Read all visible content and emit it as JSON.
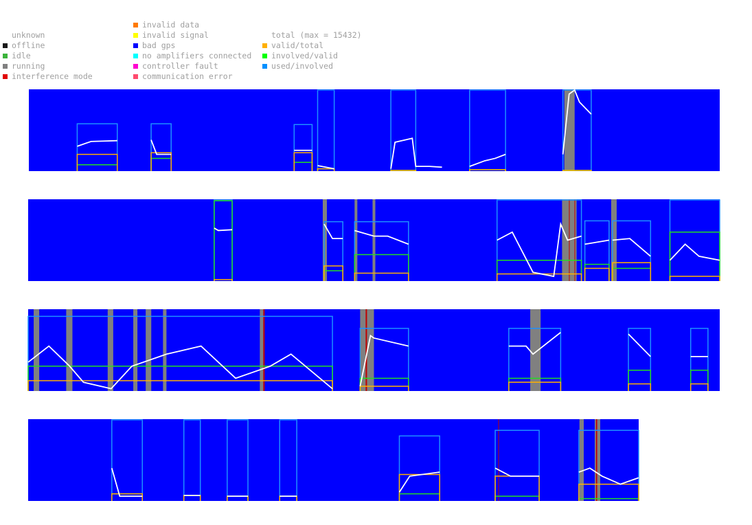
{
  "legend": {
    "columns": [
      [
        {
          "label": "unknown",
          "color": null
        },
        {
          "label": "offline",
          "color": "#1a1a1a"
        },
        {
          "label": "idle",
          "color": "#3cb33c"
        },
        {
          "label": "running",
          "color": "#808080"
        },
        {
          "label": "interference mode",
          "color": "#e00000"
        }
      ],
      [
        {
          "label": "invalid data",
          "color": "#ff7a00"
        },
        {
          "label": "invalid signal",
          "color": "#ffff00"
        },
        {
          "label": "bad gps",
          "color": "#0000ff"
        },
        {
          "label": "no amplifiers connected",
          "color": "#00ffff"
        },
        {
          "label": "controller fault",
          "color": "#ff00d0"
        },
        {
          "label": "communication error",
          "color": "#ff4a6e"
        }
      ],
      [
        {
          "label": "total (max = 15432)",
          "color": null
        },
        {
          "label": "valid/total",
          "color": "#ffb000"
        },
        {
          "label": "involved/valid",
          "color": "#00ff00"
        },
        {
          "label": "used/involved",
          "color": "#0090ff"
        }
      ]
    ]
  },
  "colors": {
    "background": "#0000ff",
    "total": "#ffffff",
    "valid_total": "#ffb000",
    "involved_valid": "#22dd22",
    "used_involved": "#1e90ff",
    "running": "#808080",
    "interference": "#c00000"
  },
  "chart_data": {
    "type": "line",
    "y_range": [
      0,
      1
    ],
    "series_names": [
      "total (max = 15432)",
      "valid/total",
      "involved/valid",
      "used/involved"
    ],
    "strips": [
      {
        "x_range": [
          0,
          1
        ],
        "segments": [
          {
            "x": [
              0.07,
              0.128
            ],
            "used": 0.58,
            "involved": 0.07,
            "valid": 0.2,
            "total": [
              [
                0.07,
                0.3
              ],
              [
                0.09,
                0.36
              ],
              [
                0.128,
                0.37
              ]
            ]
          },
          {
            "x": [
              0.177,
              0.206
            ],
            "used": 0.58,
            "involved": 0.15,
            "valid": 0.22,
            "total": [
              [
                0.177,
                0.38
              ],
              [
                0.185,
                0.2
              ],
              [
                0.206,
                0.2
              ]
            ]
          },
          {
            "x": [
              0.384,
              0.41
            ],
            "used": 0.57,
            "involved": 0.1,
            "valid": 0.22,
            "total": [
              [
                0.384,
                0.25
              ],
              [
                0.41,
                0.25
              ]
            ]
          },
          {
            "x": [
              0.418,
              0.442
            ],
            "used": 1.0,
            "involved": 0.02,
            "valid": 0.02,
            "total": [
              [
                0.418,
                0.06
              ],
              [
                0.442,
                0.02
              ]
            ]
          },
          {
            "x": [
              0.524,
              0.56
            ],
            "used": 1.0,
            "involved": 0.0,
            "valid": 0.0,
            "total": [
              [
                0.524,
                0.02
              ],
              [
                0.53,
                0.35
              ],
              [
                0.555,
                0.4
              ],
              [
                0.56,
                0.05
              ],
              [
                0.58,
                0.05
              ],
              [
                0.598,
                0.04
              ]
            ]
          },
          {
            "x": [
              0.638,
              0.69
            ],
            "used": 1.0,
            "involved": 0.01,
            "valid": 0.01,
            "total": [
              [
                0.638,
                0.05
              ],
              [
                0.66,
                0.12
              ],
              [
                0.675,
                0.15
              ],
              [
                0.69,
                0.2
              ]
            ]
          },
          {
            "x": [
              0.773,
              0.814
            ],
            "used": 1.0,
            "involved": 0.0,
            "valid": 0.0,
            "total": [
              [
                0.773,
                0.2
              ],
              [
                0.782,
                0.95
              ],
              [
                0.79,
                1.0
              ],
              [
                0.797,
                0.85
              ],
              [
                0.814,
                0.7
              ]
            ]
          }
        ],
        "running": [
          [
            0.775,
            0.79
          ]
        ],
        "interference": []
      },
      {
        "x_range": [
          0,
          1
        ],
        "segments": [
          {
            "x": [
              0.269,
              0.295
            ],
            "used": 1.0,
            "involved": 0.99,
            "valid": 0.01,
            "total": [
              [
                0.269,
                0.65
              ],
              [
                0.275,
                0.62
              ],
              [
                0.295,
                0.63
              ]
            ]
          },
          {
            "x": [
              0.428,
              0.455
            ],
            "used": 0.73,
            "involved": 0.12,
            "valid": 0.18,
            "total": [
              [
                0.428,
                0.7
              ],
              [
                0.44,
                0.52
              ],
              [
                0.455,
                0.52
              ]
            ]
          },
          {
            "x": [
              0.472,
              0.55
            ],
            "used": 0.73,
            "involved": 0.32,
            "valid": 0.09,
            "total": [
              [
                0.472,
                0.62
              ],
              [
                0.5,
                0.55
              ],
              [
                0.52,
                0.55
              ],
              [
                0.55,
                0.45
              ]
            ]
          },
          {
            "x": [
              0.678,
              0.8
            ],
            "used": 1.0,
            "involved": 0.25,
            "valid": 0.08,
            "total": [
              [
                0.678,
                0.5
              ],
              [
                0.7,
                0.6
              ],
              [
                0.73,
                0.1
              ],
              [
                0.76,
                0.05
              ],
              [
                0.77,
                0.7
              ],
              [
                0.78,
                0.5
              ],
              [
                0.8,
                0.55
              ]
            ]
          },
          {
            "x": [
              0.805,
              0.84
            ],
            "used": 0.74,
            "involved": 0.2,
            "valid": 0.15,
            "total": [
              [
                0.805,
                0.45
              ],
              [
                0.84,
                0.5
              ]
            ]
          },
          {
            "x": [
              0.845,
              0.9
            ],
            "used": 0.74,
            "involved": 0.15,
            "valid": 0.22,
            "total": [
              [
                0.845,
                0.5
              ],
              [
                0.87,
                0.52
              ],
              [
                0.9,
                0.3
              ]
            ]
          },
          {
            "x": [
              0.928,
              1.0
            ],
            "used": 1.0,
            "involved": 0.6,
            "valid": 0.05,
            "total": [
              [
                0.928,
                0.25
              ],
              [
                0.95,
                0.45
              ],
              [
                0.97,
                0.3
              ],
              [
                1.0,
                0.25
              ]
            ]
          }
        ],
        "running": [
          [
            0.426,
            0.432
          ],
          [
            0.472,
            0.476
          ],
          [
            0.498,
            0.502
          ],
          [
            0.772,
            0.793
          ],
          [
            0.843,
            0.851
          ]
        ],
        "interference": [
          [
            0.782,
            0.783
          ],
          [
            0.79,
            0.791
          ]
        ]
      },
      {
        "x_range": [
          0,
          1
        ],
        "segments": [
          {
            "x": [
              0.0,
              0.44
            ],
            "used": 0.92,
            "involved": 0.3,
            "valid": 0.12,
            "total": [
              [
                0.0,
                0.35
              ],
              [
                0.03,
                0.55
              ],
              [
                0.06,
                0.3
              ],
              [
                0.08,
                0.1
              ],
              [
                0.12,
                0.02
              ],
              [
                0.15,
                0.3
              ],
              [
                0.2,
                0.45
              ],
              [
                0.25,
                0.55
              ],
              [
                0.3,
                0.15
              ],
              [
                0.35,
                0.3
              ],
              [
                0.38,
                0.45
              ],
              [
                0.44,
                0.02
              ]
            ]
          },
          {
            "x": [
              0.48,
              0.55
            ],
            "used": 0.77,
            "involved": 0.15,
            "valid": 0.05,
            "total": [
              [
                0.48,
                0.05
              ],
              [
                0.495,
                0.68
              ],
              [
                0.5,
                0.65
              ],
              [
                0.55,
                0.55
              ]
            ]
          },
          {
            "x": [
              0.695,
              0.77
            ],
            "used": 0.77,
            "involved": 0.15,
            "valid": 0.1,
            "total": [
              [
                0.695,
                0.55
              ],
              [
                0.72,
                0.55
              ],
              [
                0.73,
                0.45
              ],
              [
                0.77,
                0.72
              ]
            ]
          },
          {
            "x": [
              0.868,
              0.9
            ],
            "used": 0.77,
            "involved": 0.25,
            "valid": 0.08,
            "total": [
              [
                0.868,
                0.7
              ],
              [
                0.9,
                0.42
              ]
            ]
          },
          {
            "x": [
              0.958,
              0.983
            ],
            "used": 0.77,
            "involved": 0.25,
            "valid": 0.08,
            "total": [
              [
                0.958,
                0.42
              ],
              [
                0.983,
                0.42
              ]
            ]
          }
        ],
        "running": [
          [
            0.008,
            0.016
          ],
          [
            0.055,
            0.064
          ],
          [
            0.115,
            0.123
          ],
          [
            0.152,
            0.158
          ],
          [
            0.17,
            0.178
          ],
          [
            0.195,
            0.2
          ],
          [
            0.335,
            0.34
          ],
          [
            0.48,
            0.5
          ],
          [
            0.726,
            0.741
          ]
        ],
        "interference": [
          [
            0.34,
            0.342
          ],
          [
            0.488,
            0.49
          ]
        ]
      },
      {
        "x_range": [
          0,
          1
        ],
        "segments": [
          {
            "x": [
              0.137,
              0.187
            ],
            "used": 1.0,
            "involved": 0.08,
            "valid": 0.08,
            "total": [
              [
                0.137,
                0.4
              ],
              [
                0.15,
                0.05
              ],
              [
                0.187,
                0.05
              ]
            ]
          },
          {
            "x": [
              0.255,
              0.282
            ],
            "used": 1.0,
            "involved": 0.06,
            "valid": 0.06,
            "total": [
              [
                0.255,
                0.06
              ],
              [
                0.282,
                0.06
              ]
            ]
          },
          {
            "x": [
              0.326,
              0.36
            ],
            "used": 1.0,
            "involved": 0.05,
            "valid": 0.05,
            "total": [
              [
                0.326,
                0.05
              ],
              [
                0.36,
                0.05
              ]
            ]
          },
          {
            "x": [
              0.412,
              0.44
            ],
            "used": 1.0,
            "involved": 0.05,
            "valid": 0.05,
            "total": [
              [
                0.412,
                0.05
              ],
              [
                0.44,
                0.05
              ]
            ]
          },
          {
            "x": [
              0.608,
              0.674
            ],
            "used": 0.8,
            "involved": 0.08,
            "valid": 0.32,
            "total": [
              [
                0.608,
                0.1
              ],
              [
                0.625,
                0.3
              ],
              [
                0.674,
                0.35
              ]
            ]
          },
          {
            "x": [
              0.765,
              0.837
            ],
            "used": 0.87,
            "involved": 0.05,
            "valid": 0.3,
            "total": [
              [
                0.765,
                0.4
              ],
              [
                0.79,
                0.3
              ],
              [
                0.81,
                0.3
              ],
              [
                0.837,
                0.3
              ]
            ]
          },
          {
            "x": [
              0.902,
              1.0
            ],
            "used": 0.87,
            "involved": 0.02,
            "valid": 0.2,
            "total": [
              [
                0.902,
                0.35
              ],
              [
                0.92,
                0.4
              ],
              [
                0.94,
                0.3
              ],
              [
                0.97,
                0.2
              ],
              [
                1.0,
                0.28
              ]
            ]
          }
        ],
        "running": [
          [
            0.903,
            0.91
          ],
          [
            0.928,
            0.937
          ]
        ],
        "interference": [
          [
            0.77,
            0.771
          ],
          [
            0.93,
            0.932
          ]
        ]
      }
    ]
  }
}
